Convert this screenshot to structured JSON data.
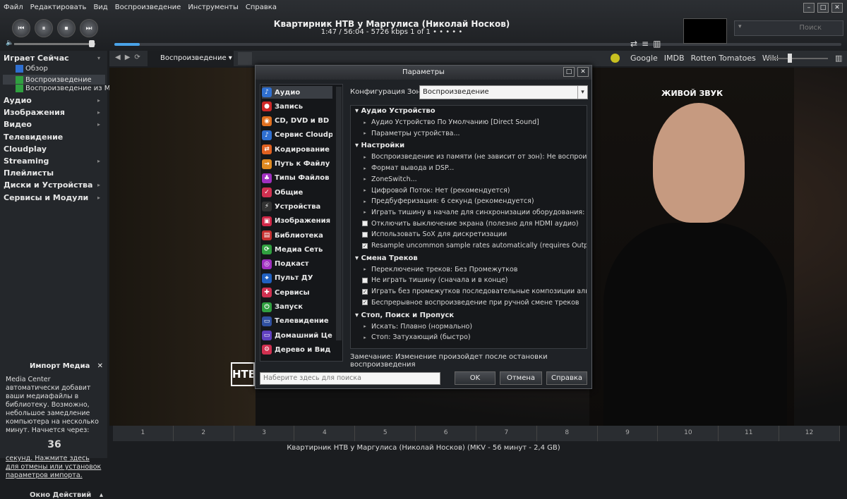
{
  "menu": [
    "Файл",
    "Редактировать",
    "Вид",
    "Воспроизведение",
    "Инструменты",
    "Справка"
  ],
  "player": {
    "title": "Квартирник НТВ у Маргулиса (Николай Носков)",
    "info": "1:47 / 56:04 - 5726 kbps   1 of 1   • • • • •",
    "search_placeholder": "Поиск",
    "progress_fraction": 0.035
  },
  "toolbar2": {
    "view_label": "Воспроизведение ▾",
    "links": [
      "Google",
      "IMDB",
      "Rotten Tomatoes",
      "Wiki"
    ]
  },
  "sidebar": {
    "playing_now": "Играет Сейчас",
    "sub_items": [
      "Обзор",
      "Воспроизведение",
      "Воспроизведение из Ма..."
    ],
    "items": [
      "Аудио",
      "Изображения",
      "Видео",
      "Телевидение",
      "Cloudplay",
      "Streaming",
      "Плейлисты",
      "Диски и Устройства",
      "Сервисы и Модули"
    ],
    "import_title": "Импорт Медиа",
    "import_text": "Media Center автоматически добавит ваши медиафайлы в библиотеку. Возможно, небольшое замедление компьютера на несколько минут. Начнется через:",
    "import_count": "36",
    "import_link": "секунд. Нажмите здесь для отмены или установок параметров импорта.",
    "action_window": "Окно Действий"
  },
  "video_caption": "ЖИВОЙ ЗВУК",
  "timeline": [
    "1",
    "2",
    "3",
    "4",
    "5",
    "6",
    "7",
    "8",
    "9",
    "10",
    "11",
    "12"
  ],
  "status": "Квартирник НТВ у Маргулиса (Николай Носков) (MKV - 56 минут - 2,4 GB)",
  "dialog": {
    "title": "Параметры",
    "categories": [
      {
        "label": "Аудио",
        "color": "#2f6fd0",
        "icon": "♪"
      },
      {
        "label": "Запись",
        "color": "#d02828",
        "icon": "●"
      },
      {
        "label": "CD, DVD и BD",
        "color": "#e07020",
        "icon": "◉"
      },
      {
        "label": "Сервис Cloudp...",
        "color": "#2f6fd0",
        "icon": "♪"
      },
      {
        "label": "Кодирование",
        "color": "#e06020",
        "icon": "⇄"
      },
      {
        "label": "Путь к Файлу",
        "color": "#e08a20",
        "icon": "→"
      },
      {
        "label": "Типы Файлов",
        "color": "#a030c0",
        "icon": "♣"
      },
      {
        "label": "Общие",
        "color": "#d03050",
        "icon": "✓"
      },
      {
        "label": "Устройства",
        "color": "#333333",
        "icon": "⚡"
      },
      {
        "label": "Изображения",
        "color": "#d02848",
        "icon": "▣"
      },
      {
        "label": "Библиотека",
        "color": "#c83030",
        "icon": "▤"
      },
      {
        "label": "Медиа Сеть",
        "color": "#30a040",
        "icon": "⟳"
      },
      {
        "label": "Подкаст",
        "color": "#a030c0",
        "icon": "◎"
      },
      {
        "label": "Пульт ДУ",
        "color": "#2060c0",
        "icon": "⌖"
      },
      {
        "label": "Сервисы",
        "color": "#d03050",
        "icon": "✚"
      },
      {
        "label": "Запуск",
        "color": "#30a040",
        "icon": "⏻"
      },
      {
        "label": "Телевидение",
        "color": "#3050a0",
        "icon": "▭"
      },
      {
        "label": "Домашний Це...",
        "color": "#6040c0",
        "icon": "▭"
      },
      {
        "label": "Дерево и Вид",
        "color": "#d03050",
        "icon": "⚙"
      }
    ],
    "zone_label": "Конфигурация Зоны:",
    "zone_value": "Воспроизведение",
    "groups": [
      {
        "title": "Аудио Устройство",
        "options": [
          {
            "type": "bullet",
            "text": "Аудио Устройство По Умолчанию [Direct Sound]"
          },
          {
            "type": "bullet",
            "text": "Параметры устройства..."
          }
        ]
      },
      {
        "title": "Настройки",
        "options": [
          {
            "type": "bullet",
            "text": "Воспроизведение из памяти (не зависит от зон): Не воспроизвод..."
          },
          {
            "type": "bullet",
            "text": "Формат вывода и DSP..."
          },
          {
            "type": "bullet",
            "text": "ZoneSwitch..."
          },
          {
            "type": "bullet",
            "text": "Цифровой Поток: Нет (рекомендуется)"
          },
          {
            "type": "bullet",
            "text": "Предбуферизация: 6 секунд (рекомендуется)"
          },
          {
            "type": "bullet",
            "text": "Играть тишину в начале для синхронизации оборудования: Нет"
          },
          {
            "type": "check",
            "checked": false,
            "text": "Отключить выключение экрана (полезно для HDMI аудио)"
          },
          {
            "type": "check",
            "checked": false,
            "text": "Использовать SoX для дискретизации"
          },
          {
            "type": "check",
            "checked": true,
            "text": "Resample uncommon sample rates automatically (requires Output F..."
          }
        ]
      },
      {
        "title": "Смена Треков",
        "options": [
          {
            "type": "bullet",
            "text": "Переключение треков: Без Промежутков"
          },
          {
            "type": "check",
            "checked": false,
            "text": "Не играть тишину (сначала и в конце)"
          },
          {
            "type": "check",
            "checked": true,
            "text": "Играть без промежутков последовательные композиции альбома"
          },
          {
            "type": "check",
            "checked": true,
            "text": "Беспрерывное воспроизведение при ручной смене треков"
          }
        ]
      },
      {
        "title": "Стоп, Поиск и Пропуск",
        "options": [
          {
            "type": "bullet",
            "text": "Искать: Плавно (нормально)"
          },
          {
            "type": "bullet",
            "text": "Стоп: Затухающий (быстро)"
          }
        ]
      }
    ],
    "note": "Замечание: Изменение произойдет после остановки воспроизведения",
    "search_placeholder": "Наберите здесь для поиска",
    "ok": "OK",
    "cancel": "Отмена",
    "help": "Справка"
  }
}
